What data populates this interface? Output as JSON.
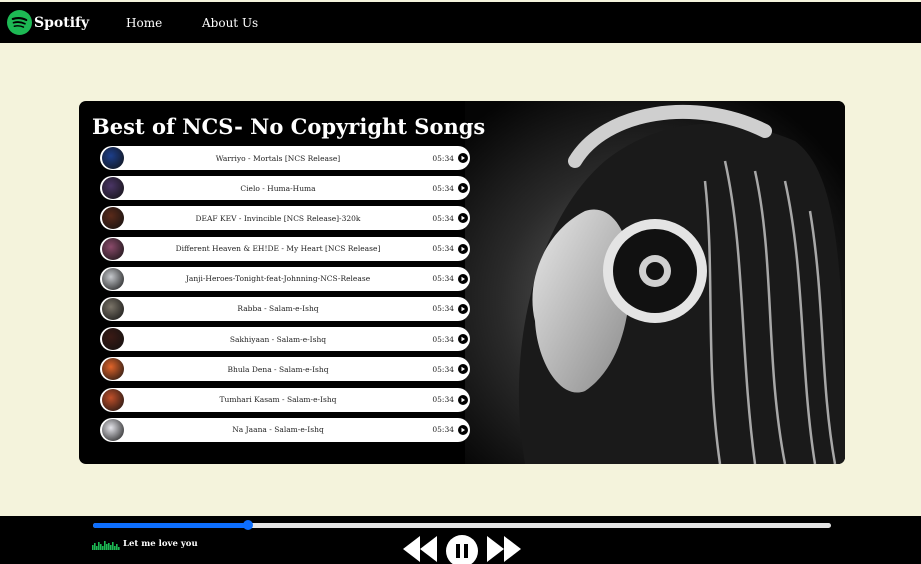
{
  "nav": {
    "brand": "Spotify",
    "home": "Home",
    "about": "About Us"
  },
  "main": {
    "title": "Best of NCS- No Copyright Songs",
    "songs": [
      {
        "name": "Warriyo - Mortals [NCS Release]",
        "time": "05:34",
        "cover_color": "#1c3e8a"
      },
      {
        "name": "Cielo - Huma-Huma",
        "time": "05:34",
        "cover_color": "#4a3565"
      },
      {
        "name": "DEAF KEV - Invincible [NCS Release]-320k",
        "time": "05:34",
        "cover_color": "#5a2a1a"
      },
      {
        "name": "Different Heaven & EH!DE - My Heart [NCS Release]",
        "time": "05:34",
        "cover_color": "#8a4a6a"
      },
      {
        "name": "Janji-Heroes-Tonight-feat-Johnning-NCS-Release",
        "time": "05:34",
        "cover_color": "#c5c8cc"
      },
      {
        "name": "Rabba - Salam-e-Ishq",
        "time": "05:34",
        "cover_color": "#7a7468"
      },
      {
        "name": "Sakhiyaan - Salam-e-Ishq",
        "time": "05:34",
        "cover_color": "#3a1a14"
      },
      {
        "name": "Bhula Dena - Salam-e-Ishq",
        "time": "05:34",
        "cover_color": "#e0642a"
      },
      {
        "name": "Tumhari Kasam - Salam-e-Ishq",
        "time": "05:34",
        "cover_color": "#c0502a"
      },
      {
        "name": "Na Jaana - Salam-e-Ishq",
        "time": "05:34",
        "cover_color": "#e4e4ea"
      }
    ]
  },
  "player": {
    "now_playing": "Let me love you",
    "progress": 0.21,
    "accent": "#0d6efd"
  },
  "colors": {
    "background": "#f4f3dc",
    "bars": "#000000",
    "spotify_green": "#1db954"
  },
  "icons": {
    "logo": "spotify-logo",
    "previous": "previous-icon",
    "pause": "pause-icon",
    "next": "next-icon",
    "play": "play-icon"
  }
}
